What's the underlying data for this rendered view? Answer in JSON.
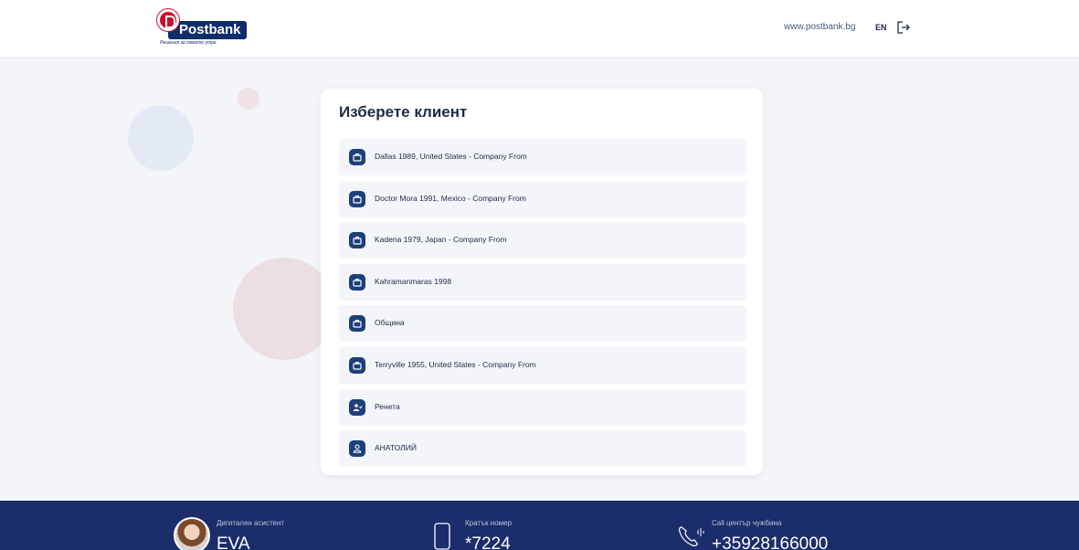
{
  "header": {
    "logo_text": "Postbank",
    "logo_tagline": "Решения за твоето утре",
    "site_link": "www.postbank.bg",
    "lang_label": "EN",
    "logout_icon": "logout-icon"
  },
  "card": {
    "title": "Изберете клиент",
    "clients": [
      {
        "label": "Dallas 1989, United States - Company From",
        "icon": "briefcase-icon"
      },
      {
        "label": "Doctor Mora 1991, Mexico - Company From",
        "icon": "briefcase-icon"
      },
      {
        "label": "Kadena 1979, Japan - Company From",
        "icon": "briefcase-icon"
      },
      {
        "label": "Kahramanmaras 1998",
        "icon": "briefcase-icon"
      },
      {
        "label": "Община",
        "icon": "briefcase-icon"
      },
      {
        "label": "Terryville 1955, United States - Company From",
        "icon": "briefcase-icon"
      },
      {
        "label": "Ренета",
        "icon": "user-check-icon"
      },
      {
        "label": "АНАТОЛИЙ",
        "icon": "user-icon"
      }
    ]
  },
  "footer": {
    "assistant_label": "Дигитален асистент",
    "assistant_value": "EVA",
    "short_number_label": "Кратък номер",
    "short_number_value": "*7224",
    "callcenter_label": "Call център чужбина",
    "callcenter_value": "+35928166000"
  },
  "colors": {
    "brand_navy": "#1b2d6b",
    "brand_red": "#c8102e",
    "icon_blue": "#1d3f7a",
    "page_bg": "#f3f5f9"
  }
}
